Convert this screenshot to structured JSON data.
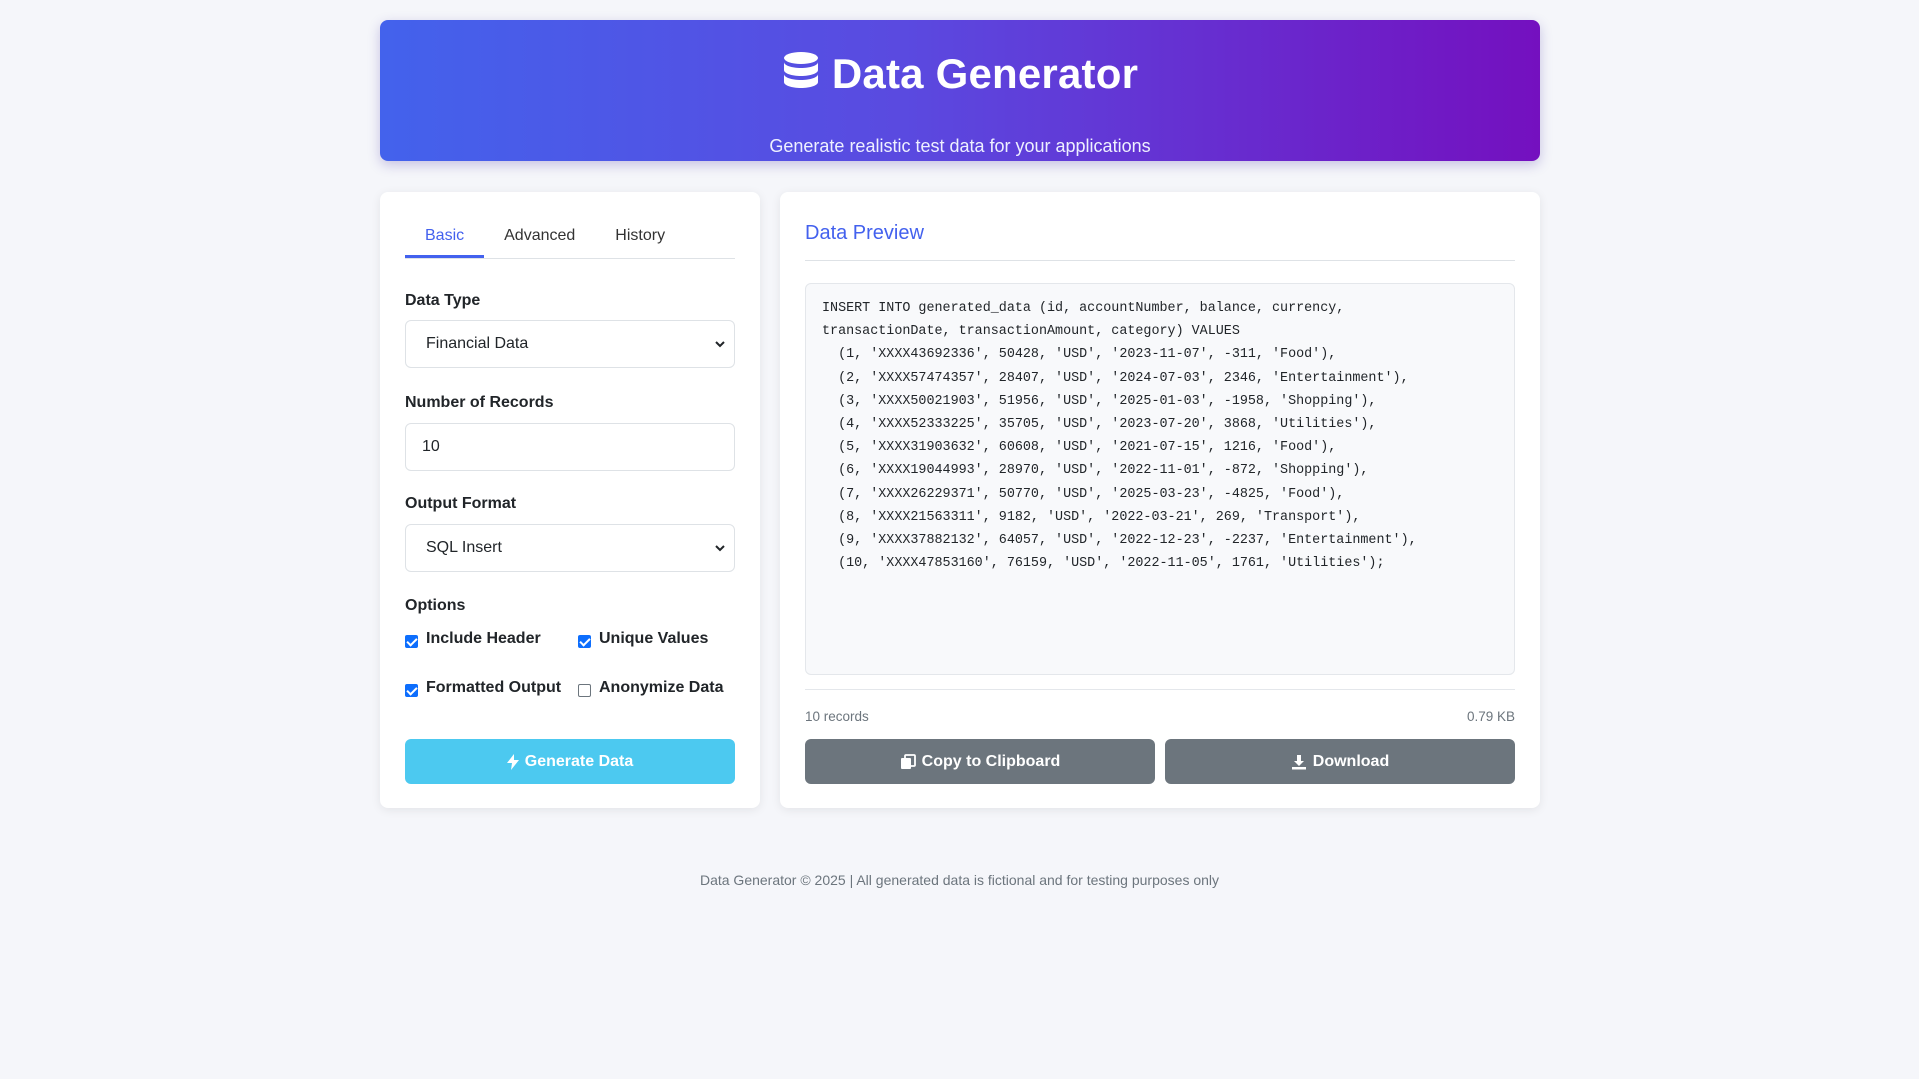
{
  "header": {
    "title": "Data Generator",
    "subtitle": "Generate realistic test data for your applications",
    "icon": "database-icon"
  },
  "tabs": [
    {
      "label": "Basic",
      "active": true
    },
    {
      "label": "Advanced",
      "active": false
    },
    {
      "label": "History",
      "active": false
    }
  ],
  "form": {
    "data_type_label": "Data Type",
    "data_type_value": "Financial Data",
    "records_label": "Number of Records",
    "records_value": "10",
    "format_label": "Output Format",
    "format_value": "SQL Insert",
    "options_label": "Options",
    "options": [
      {
        "label": "Include Header",
        "checked": true
      },
      {
        "label": "Unique Values",
        "checked": true
      },
      {
        "label": "Formatted Output",
        "checked": true
      },
      {
        "label": "Anonymize Data",
        "checked": false
      }
    ],
    "generate_label": "Generate Data"
  },
  "preview": {
    "title": "Data Preview",
    "code_lines": [
      "INSERT INTO generated_data (id, accountNumber, balance, currency,",
      "transactionDate, transactionAmount, category) VALUES",
      "  (1, 'XXXX43692336', 50428, 'USD', '2023-11-07', -311, 'Food'),",
      "  (2, 'XXXX57474357', 28407, 'USD', '2024-07-03', 2346, 'Entertainment'),",
      "  (3, 'XXXX50021903', 51956, 'USD', '2025-01-03', -1958, 'Shopping'),",
      "  (4, 'XXXX52333225', 35705, 'USD', '2023-07-20', 3868, 'Utilities'),",
      "  (5, 'XXXX31903632', 60608, 'USD', '2021-07-15', 1216, 'Food'),",
      "  (6, 'XXXX19044993', 28970, 'USD', '2022-11-01', -872, 'Shopping'),",
      "  (7, 'XXXX26229371', 50770, 'USD', '2025-03-23', -4825, 'Food'),",
      "  (8, 'XXXX21563311', 9182, 'USD', '2022-03-21', 269, 'Transport'),",
      "  (9, 'XXXX37882132', 64057, 'USD', '2022-12-23', -2237, 'Entertainment'),",
      "  (10, 'XXXX47853160', 76159, 'USD', '2022-11-05', 1761, 'Utilities');"
    ],
    "record_count": "10 records",
    "size": "0.79 KB",
    "copy_label": "Copy to Clipboard",
    "download_label": "Download"
  },
  "footer": {
    "text": "Data Generator © 2025 | All generated data is fictional and for testing purposes only"
  },
  "colors": {
    "accent": "#4361ee",
    "generate_button": "#4cc9f0",
    "secondary_button": "#6c757d",
    "header_gradient_start": "#4362ec",
    "header_gradient_end": "#7410bf"
  }
}
